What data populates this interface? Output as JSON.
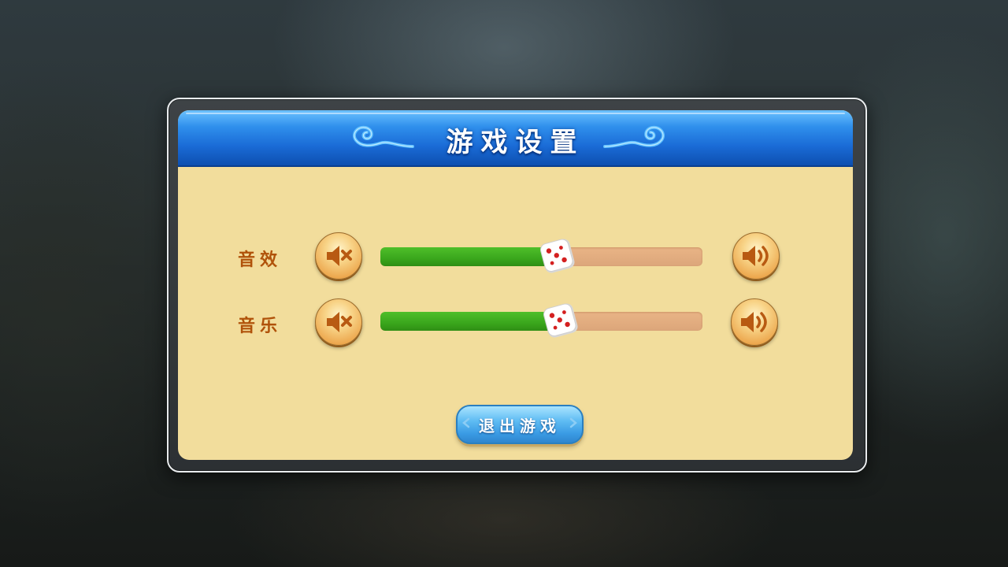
{
  "dialog": {
    "title": "游戏设置"
  },
  "settings": {
    "sound_effects": {
      "label": "音效",
      "level_percent": 55
    },
    "music": {
      "label": "音乐",
      "level_percent": 56
    }
  },
  "icons": {
    "mute": "speaker-mute-icon",
    "volume": "speaker-volume-icon",
    "slider_handle": "dice-icon",
    "title_decor": "cloud-swirl-icon"
  },
  "exit_button": {
    "label": "退出游戏"
  },
  "colors": {
    "header_blue": "#1a6bd6",
    "panel_bg": "#f2dd9c",
    "label_text": "#b0520a",
    "slider_fill": "#3aa61c",
    "slider_track": "#dca67a",
    "button_orange": "#eda950",
    "exit_button_blue": "#3a9be4"
  }
}
